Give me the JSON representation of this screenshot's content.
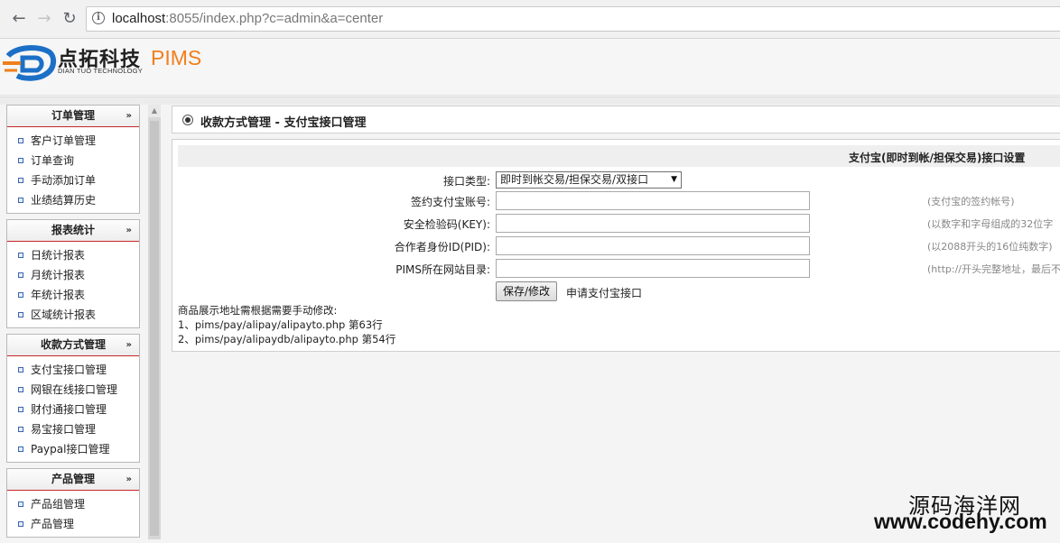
{
  "browser": {
    "url_host": "localhost",
    "url_rest": ":8055/index.php?c=admin&a=center",
    "back_icon": "arrow-left-icon",
    "forward_icon": "arrow-right-icon",
    "reload_icon": "reload-icon",
    "info_icon": "info-icon"
  },
  "header": {
    "logo_cn": "点拓科技",
    "logo_en": "DIAN TUO TECHNOLOGY",
    "logo_product": "PIMS",
    "brand_color": "#f07f1c",
    "logo_mark_color": "#1c6fc6"
  },
  "sidebar": {
    "groups": [
      {
        "title": "订单管理",
        "items": [
          "客户订单管理",
          "订单查询",
          "手动添加订单",
          "业绩结算历史"
        ]
      },
      {
        "title": "报表统计",
        "items": [
          "日统计报表",
          "月统计报表",
          "年统计报表",
          "区域统计报表"
        ]
      },
      {
        "title": "收款方式管理",
        "items": [
          "支付宝接口管理",
          "网银在线接口管理",
          "财付通接口管理",
          "易宝接口管理",
          "Paypal接口管理"
        ]
      },
      {
        "title": "产品管理",
        "items": [
          "产品组管理",
          "产品管理"
        ]
      }
    ],
    "collapse_glyph": "»",
    "accent_color": "#c62828"
  },
  "main": {
    "page_title": "收款方式管理 - 支付宝接口管理",
    "section_title": "支付宝(即时到帐/担保交易)接口设置",
    "form": {
      "interface_type_label": "接口类型:",
      "interface_type_value": "即时到帐交易/担保交易/双接口",
      "account_label": "签约支付宝账号:",
      "account_value": "",
      "account_hint": "(支付宝的签约帐号)",
      "key_label": "安全检验码(KEY):",
      "key_value": "",
      "key_hint": "(以数字和字母组成的32位字",
      "pid_label": "合作者身份ID(PID):",
      "pid_value": "",
      "pid_hint": "(以2088开头的16位纯数字)",
      "dir_label": "PIMS所在网站目录:",
      "dir_value": "",
      "dir_hint": "(http://开头完整地址，最后不",
      "save_label": "保存/修改",
      "apply_label": "申请支付宝接口"
    },
    "notes": [
      "商品展示地址需根据需要手动修改:",
      "1、pims/pay/alipay/alipayto.php 第63行",
      "2、pims/pay/alipaydb/alipayto.php 第54行"
    ]
  },
  "watermark": {
    "cn": "源码海洋网",
    "url": "www.codehy.com"
  }
}
